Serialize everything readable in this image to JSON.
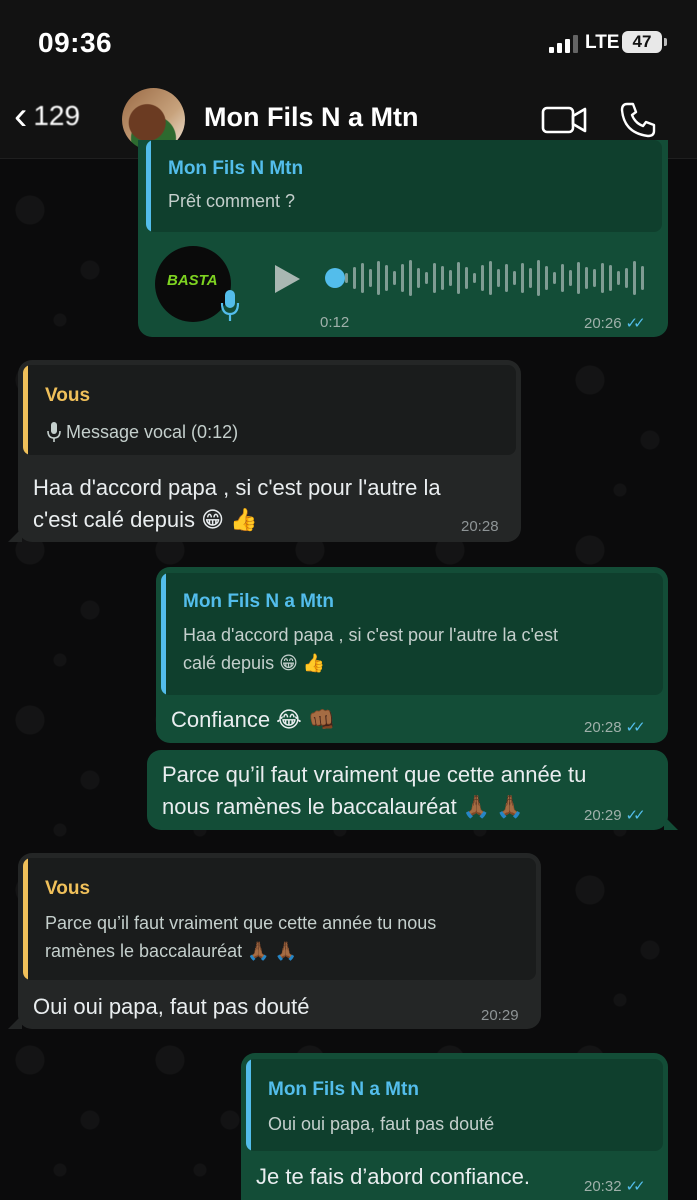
{
  "status_bar": {
    "time": "09:36",
    "network": "LTE",
    "battery": "47"
  },
  "header": {
    "back_count": "129",
    "contact_name": "Mon Fils N     a Mtn"
  },
  "messages": [
    {
      "quote_author": "Mon Fils N     Mtn",
      "quote_text": "Prêt comment ?",
      "voice_duration": "0:12",
      "time": "20:26",
      "voice_thumb_text": "BASTA"
    },
    {
      "quote_author": "Vous",
      "quote_text": "Message vocal (0:12)",
      "text_line1": "Haa d'accord papa , si c'est pour l'autre la",
      "text_line2": "c'est calé depuis 😁 👍",
      "time": "20:28"
    },
    {
      "quote_author": "Mon Fils N       a Mtn",
      "quote_line1": "Haa d'accord papa , si c'est pour l'autre la c'est",
      "quote_line2": "calé depuis 😁 👍",
      "text": "Confiance 😂 👊🏾",
      "time": "20:28"
    },
    {
      "text_line1": "Parce qu’il faut vraiment que cette année tu",
      "text_line2": "nous ramènes le baccalauréat 🙏🏾 🙏🏾",
      "time": "20:29"
    },
    {
      "quote_author": "Vous",
      "quote_line1": "Parce qu’il faut vraiment que cette année tu nous",
      "quote_line2": "ramènes le baccalauréat 🙏🏾 🙏🏾",
      "text": "Oui oui papa, faut pas douté",
      "time": "20:29"
    },
    {
      "quote_author": "Mon Fils N        a Mtn",
      "quote_text": "Oui oui papa, faut pas douté",
      "text": "Je te fais d’abord confiance.",
      "time": "20:32"
    }
  ],
  "colors": {
    "outgoing_bubble": "#134d37",
    "incoming_bubble": "#242626",
    "contact_quote": "#53bdeb",
    "you_quote": "#f0c05a",
    "read_ticks": "#53bdeb"
  },
  "icons": [
    "back-chevron-icon",
    "video-call-icon",
    "phone-call-icon",
    "microphone-icon",
    "play-icon",
    "double-check-icon"
  ]
}
